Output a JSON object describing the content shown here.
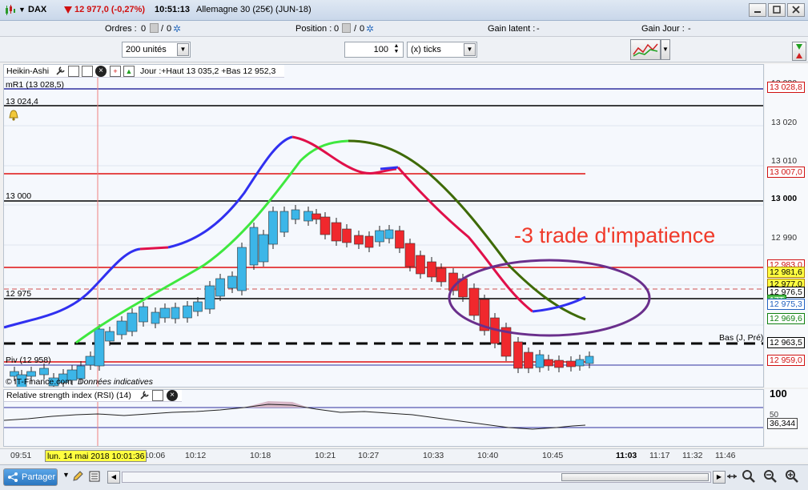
{
  "titlebar": {
    "instrument": "DAX",
    "price": "12 977,0 (-0,27%)",
    "time": "10:51:13",
    "contract": "Allemagne 30 (25€) (JUN-18)"
  },
  "infobar": {
    "orders_label": "Ordres :",
    "orders_value": "0",
    "orders_value2": "0",
    "position_label": "Position :",
    "position_value": "0",
    "position_value2": "0",
    "latent_label": "Gain latent :",
    "latent_value": "-",
    "day_label": "Gain Jour :",
    "day_value": "-"
  },
  "toolbar": {
    "units": "200 unités",
    "interval_value": "100",
    "interval_unit": "(x) ticks"
  },
  "chart": {
    "header_type": "Heikin-Ashi",
    "header_info": "Jour :+Haut 13 035,2 +Bas 12 952,3",
    "mr1_label": "mR1 (13 028,5)",
    "level_13024": "13 024,4",
    "level_13000": "13 000",
    "level_12975": "12 975",
    "bas_label": "Bas (J, Pré)",
    "piv_label": "Piv (12 958)",
    "source_label": "© IT-Finance.com",
    "source_note": "Données indicatives",
    "annotation": "-3 trade d'impatience",
    "colors": {
      "up": "#3cb6e8",
      "down": "#f0282d",
      "fast_up": "#3030f0",
      "fast_down": "#e0104a",
      "slow_up": "#3fe83f",
      "slow_down": "#3e6a06",
      "annotation": "#f03a2a",
      "ellipse": "#6a2f8c"
    }
  },
  "yaxis": {
    "ticks": [
      "13 020",
      "13 010",
      "13 000",
      "12 990"
    ],
    "top_tick": "13 030",
    "tags": [
      {
        "text": "13 028,8",
        "color": "#d01010"
      },
      {
        "text": "13 007,0",
        "color": "#d01010"
      },
      {
        "text": "12 983,0",
        "color": "#d01010"
      },
      {
        "text": "12 981,6",
        "color": "#b08000"
      },
      {
        "text": "12 977,0",
        "color": "#b08000"
      },
      {
        "text": "12 976,5",
        "color": "#000000"
      },
      {
        "text": "17T",
        "color": "#108010"
      },
      {
        "text": "12 975,3",
        "color": "#2060c0"
      },
      {
        "text": "12 969,6",
        "color": "#108010"
      },
      {
        "text": "12 963,5",
        "color": "#000000"
      },
      {
        "text": "12 959,0",
        "color": "#d01010"
      }
    ]
  },
  "rsi": {
    "label": "Relative strength index (RSI) (14)",
    "axis_100": "100",
    "axis_50": "50",
    "value": "36,344"
  },
  "xaxis": {
    "ticks": [
      "09:51",
      "10:06",
      "10:12",
      "10:18",
      "10:21",
      "10:27",
      "10:33",
      "10:40",
      "10:45",
      "11:03",
      "11:17",
      "11:32",
      "11:46"
    ],
    "cursor_label": "lun. 14 mai 2018 10:01:36",
    "bold_tick": "11:03"
  },
  "bottombar": {
    "share_label": "Partager"
  },
  "ha_candles": [
    [
      13,
      383,
      11,
      389,
      1
    ],
    [
      22,
      387,
      12,
      404,
      1
    ],
    [
      34,
      383,
      11,
      389,
      1
    ],
    [
      50,
      379,
      11,
      387,
      1
    ],
    [
      62,
      391,
      12,
      401,
      1
    ],
    [
      74,
      386,
      11,
      397,
      1
    ],
    [
      85,
      381,
      12,
      394,
      1
    ],
    [
      96,
      376,
      10,
      392,
      1
    ],
    [
      108,
      364,
      12,
      375,
      1
    ],
    [
      119,
      330,
      12,
      376,
      1
    ],
    [
      132,
      333,
      11,
      345,
      1
    ],
    [
      147,
      320,
      12,
      337,
      1
    ],
    [
      160,
      310,
      12,
      333,
      1
    ],
    [
      174,
      302,
      11,
      321,
      1
    ],
    [
      189,
      309,
      10,
      323,
      1
    ],
    [
      201,
      304,
      12,
      316,
      1
    ],
    [
      214,
      303,
      10,
      317,
      1
    ],
    [
      229,
      301,
      11,
      316,
      1
    ],
    [
      242,
      296,
      11,
      308,
      1
    ],
    [
      257,
      276,
      12,
      305,
      1
    ],
    [
      270,
      267,
      11,
      289,
      1
    ],
    [
      285,
      264,
      11,
      279,
      1
    ],
    [
      297,
      228,
      11,
      282,
      1
    ],
    [
      312,
      203,
      10,
      250,
      1
    ],
    [
      324,
      212,
      12,
      246,
      1
    ],
    [
      336,
      183,
      11,
      224,
      1
    ],
    [
      350,
      183,
      10,
      209,
      1
    ],
    [
      364,
      181,
      10,
      193,
      1
    ],
    [
      380,
      183,
      11,
      195,
      1
    ],
    [
      390,
      186,
      11,
      193,
      0
    ],
    [
      401,
      190,
      12,
      212,
      0
    ],
    [
      415,
      197,
      12,
      220,
      0
    ],
    [
      428,
      205,
      11,
      222,
      0
    ],
    [
      443,
      213,
      11,
      224,
      0
    ],
    [
      456,
      214,
      10,
      228,
      0
    ],
    [
      469,
      207,
      11,
      221,
      1
    ],
    [
      481,
      206,
      10,
      217,
      1
    ],
    [
      494,
      207,
      11,
      229,
      0
    ],
    [
      507,
      223,
      12,
      252,
      0
    ],
    [
      520,
      238,
      11,
      261,
      0
    ],
    [
      534,
      246,
      11,
      265,
      0
    ],
    [
      546,
      254,
      12,
      271,
      0
    ],
    [
      561,
      260,
      11,
      282,
      0
    ],
    [
      573,
      267,
      11,
      290,
      0
    ],
    [
      587,
      279,
      12,
      313,
      0
    ],
    [
      600,
      293,
      12,
      332,
      0
    ],
    [
      613,
      316,
      11,
      348,
      0
    ],
    [
      627,
      328,
      12,
      364,
      0
    ],
    [
      642,
      346,
      11,
      379,
      0
    ],
    [
      655,
      359,
      11,
      379,
      0
    ],
    [
      669,
      362,
      10,
      378,
      1
    ],
    [
      680,
      368,
      11,
      376,
      0
    ],
    [
      693,
      369,
      11,
      378,
      0
    ],
    [
      708,
      370,
      11,
      377,
      0
    ],
    [
      719,
      368,
      10,
      376,
      1
    ],
    [
      731,
      364,
      10,
      373,
      1
    ]
  ]
}
